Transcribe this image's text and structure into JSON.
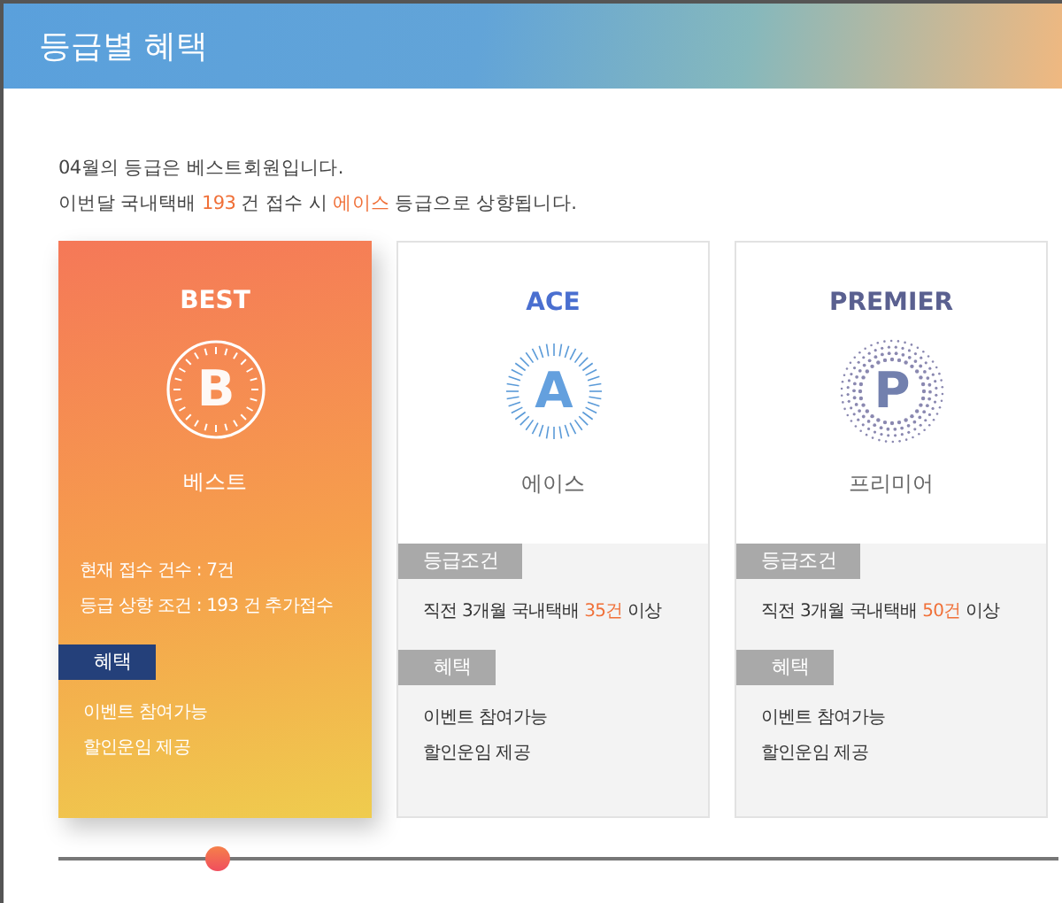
{
  "header": {
    "title": "등급별 혜택"
  },
  "intro": {
    "line_1": "04월의 등급은 베스트회원입니다.",
    "line_2": [
      {
        "text": "이번달 국내택배 ",
        "highlight": false
      },
      {
        "text": "193",
        "highlight": true
      },
      {
        "text": " 건 접수 시 ",
        "highlight": false
      },
      {
        "text": "에이스",
        "highlight": true
      },
      {
        "text": " 등급으로 상향됩니다.",
        "highlight": false
      }
    ]
  },
  "grades": [
    {
      "kind": "best",
      "selected": true,
      "title": "BEST",
      "emblem_letter": "B",
      "name": "베스트",
      "status_lines": [
        "현재 접수 건수 : 7건",
        "등급 상향 조건 : 193 건 추가접수"
      ],
      "benefit_label": "혜택",
      "benefits": [
        "이벤트 참여가능",
        "할인운임 제공"
      ]
    },
    {
      "kind": "ace",
      "selected": false,
      "title": "ACE",
      "emblem_letter": "A",
      "name": "에이스",
      "condition_label": "등급조건",
      "condition": [
        {
          "text": "직전 3개월 국내택배 ",
          "highlight": false
        },
        {
          "text": "35건",
          "highlight": true
        },
        {
          "text": " 이상",
          "highlight": false
        }
      ],
      "benefit_label": "혜택",
      "benefits": [
        "이벤트 참여가능",
        "할인운임 제공"
      ]
    },
    {
      "kind": "premier",
      "selected": false,
      "title": "PREMIER",
      "emblem_letter": "P",
      "name": "프리미어",
      "condition_label": "등급조건",
      "condition": [
        {
          "text": "직전 3개월 국내택배 ",
          "highlight": false
        },
        {
          "text": "50건",
          "highlight": true
        },
        {
          "text": " 이상",
          "highlight": false
        }
      ],
      "benefit_label": "혜택",
      "benefits": [
        "이벤트 참여가능",
        "할인운임 제공"
      ]
    }
  ],
  "progress": {
    "level": 0.16
  }
}
